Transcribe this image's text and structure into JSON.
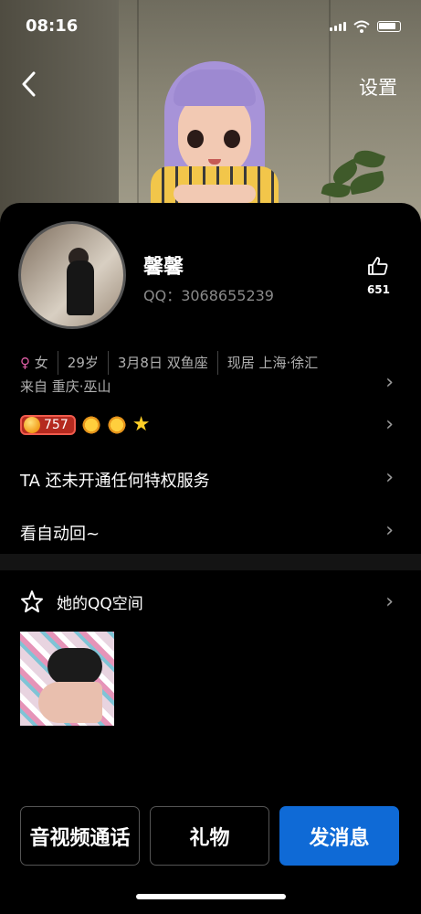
{
  "status_bar": {
    "time": "08:16"
  },
  "header": {
    "settings_label": "设置",
    "back_icon": "chevron-left-icon"
  },
  "profile": {
    "name": "馨馨",
    "qq_label": "QQ：3068655239",
    "like_count": "651"
  },
  "info": {
    "gender": "女",
    "age": "29岁",
    "birthday": "3月8日 双鱼座",
    "residence": "现居 上海·徐汇",
    "hometown": "来自 重庆·巫山"
  },
  "badges": {
    "level_number": "757"
  },
  "rows": {
    "privilege": "TA 还未开通任何特权服务",
    "auto_reply": "看自动回~"
  },
  "zone": {
    "title": "她的QQ空间"
  },
  "actions": {
    "call_label": "音视频通话",
    "gift_label": "礼物",
    "message_label": "发消息"
  },
  "colors": {
    "primary_blue": "#0f6ad6",
    "female_pink": "#e05fa6",
    "level_red": "#b52a1f"
  }
}
